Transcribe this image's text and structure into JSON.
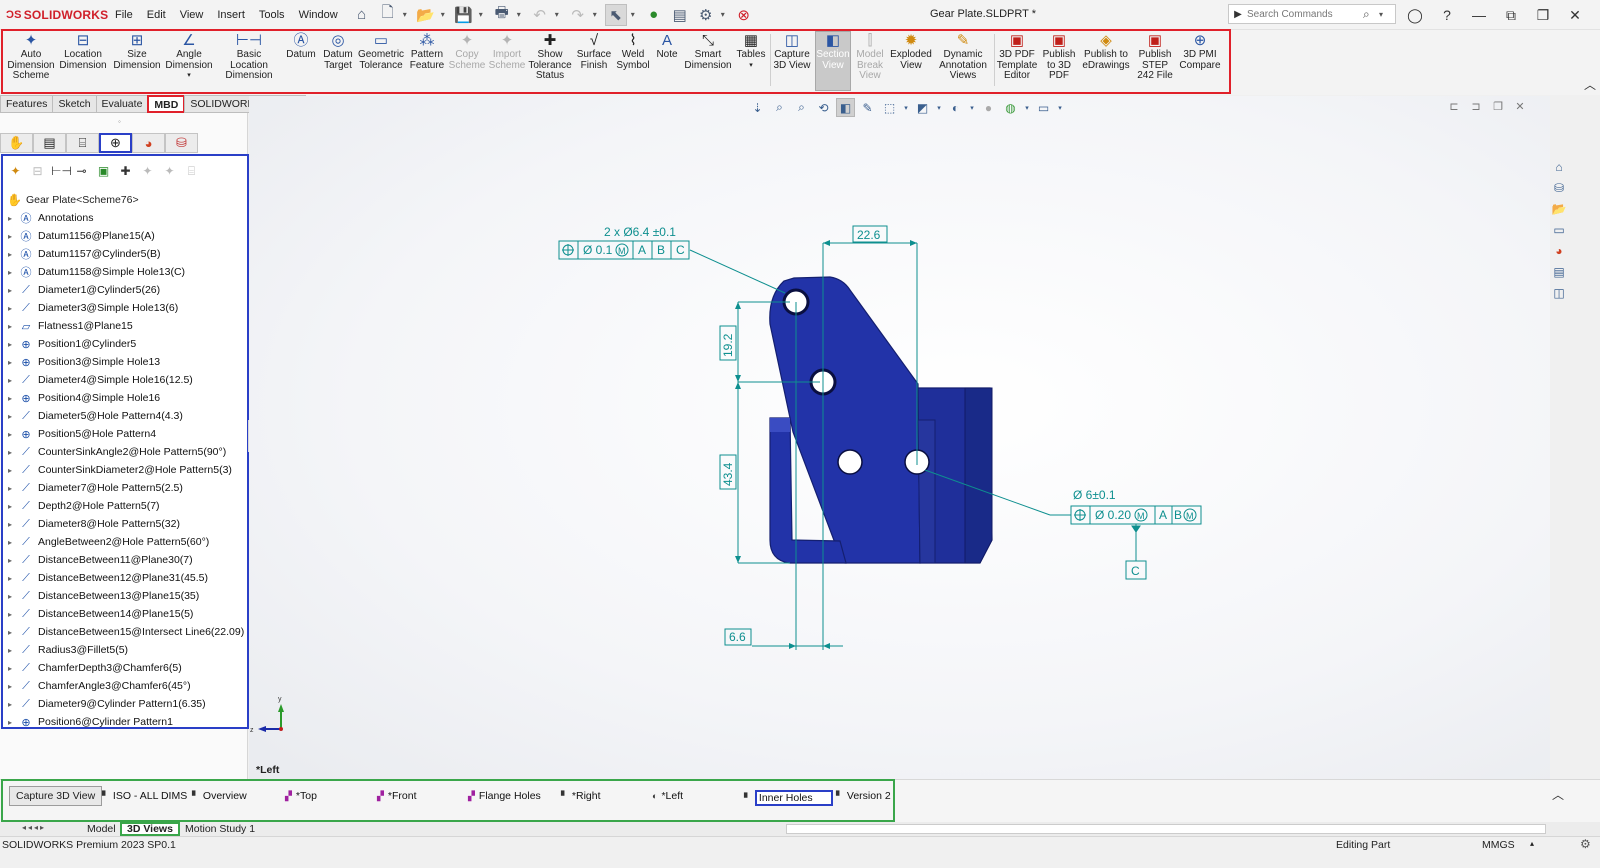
{
  "app": {
    "brand": "SOLIDWORKS",
    "document_title": "Gear Plate.SLDPRT *",
    "menus": [
      "File",
      "Edit",
      "View",
      "Insert",
      "Tools",
      "Window"
    ],
    "search_placeholder": "Search Commands"
  },
  "ribbon": {
    "buttons": [
      {
        "label": "Auto Dimension Scheme",
        "icon": "auto-dimension-icon"
      },
      {
        "label": "Location Dimension",
        "icon": "location-dimension-icon"
      },
      {
        "label": "Size Dimension",
        "icon": "size-dimension-icon"
      },
      {
        "label": "Angle Dimension",
        "icon": "angle-dimension-icon"
      },
      {
        "label": "Basic Location Dimension",
        "icon": "basic-location-icon"
      },
      {
        "label": "Datum",
        "icon": "datum-icon"
      },
      {
        "label": "Datum Target",
        "icon": "datum-target-icon"
      },
      {
        "label": "Geometric Tolerance",
        "icon": "geometric-tolerance-icon"
      },
      {
        "label": "Pattern Feature",
        "icon": "pattern-feature-icon"
      },
      {
        "label": "Copy Scheme",
        "icon": "copy-scheme-icon",
        "disabled": true
      },
      {
        "label": "Import Scheme",
        "icon": "import-scheme-icon",
        "disabled": true
      },
      {
        "label": "Show Tolerance Status",
        "icon": "tolerance-status-icon"
      },
      {
        "label": "Surface Finish",
        "icon": "surface-finish-icon"
      },
      {
        "label": "Weld Symbol",
        "icon": "weld-symbol-icon"
      },
      {
        "label": "Note",
        "icon": "note-icon"
      },
      {
        "label": "Smart Dimension",
        "icon": "smart-dimension-icon"
      },
      {
        "label": "Tables",
        "icon": "tables-icon"
      },
      {
        "label": "Capture 3D View",
        "icon": "capture-3d-view-icon"
      },
      {
        "label": "Section View",
        "icon": "section-view-icon",
        "active": true
      },
      {
        "label": "Model Break View",
        "icon": "model-break-view-icon",
        "disabled": true
      },
      {
        "label": "Exploded View",
        "icon": "exploded-view-icon"
      },
      {
        "label": "Dynamic Annotation Views",
        "icon": "dynamic-annotation-icon"
      },
      {
        "label": "3D PDF Template Editor",
        "icon": "pdf-template-icon"
      },
      {
        "label": "Publish to 3D PDF",
        "icon": "publish-pdf-icon"
      },
      {
        "label": "Publish to eDrawings",
        "icon": "publish-edrawings-icon"
      },
      {
        "label": "Publish STEP 242 File",
        "icon": "publish-step-icon"
      },
      {
        "label": "3D PMI Compare",
        "icon": "pmi-compare-icon"
      }
    ]
  },
  "cm_tabs": [
    "Features",
    "Sketch",
    "Evaluate",
    "MBD",
    "SOLIDWORKS Add-Ins"
  ],
  "tree": {
    "root": "Gear Plate<Scheme76>",
    "items": [
      {
        "label": "Annotations",
        "icon": "annotations-icon"
      },
      {
        "label": "Datum1156@Plane15(A)",
        "icon": "datum-icon"
      },
      {
        "label": "Datum1157@Cylinder5(B)",
        "icon": "datum-icon"
      },
      {
        "label": "Datum1158@Simple Hole13(C)",
        "icon": "datum-icon"
      },
      {
        "label": "Diameter1@Cylinder5(26)",
        "icon": "dimension-icon"
      },
      {
        "label": "Diameter3@Simple Hole13(6)",
        "icon": "dimension-icon"
      },
      {
        "label": "Flatness1@Plane15",
        "icon": "flatness-icon"
      },
      {
        "label": "Position1@Cylinder5",
        "icon": "position-icon"
      },
      {
        "label": "Position3@Simple Hole13",
        "icon": "position-icon"
      },
      {
        "label": "Diameter4@Simple Hole16(12.5)",
        "icon": "dimension-icon"
      },
      {
        "label": "Position4@Simple Hole16",
        "icon": "position-icon"
      },
      {
        "label": "Diameter5@Hole Pattern4(4.3)",
        "icon": "dimension-icon"
      },
      {
        "label": "Position5@Hole Pattern4",
        "icon": "position-icon"
      },
      {
        "label": "CounterSinkAngle2@Hole Pattern5(90°)",
        "icon": "dimension-icon"
      },
      {
        "label": "CounterSinkDiameter2@Hole Pattern5(3)",
        "icon": "dimension-icon"
      },
      {
        "label": "Diameter7@Hole Pattern5(2.5)",
        "icon": "dimension-icon"
      },
      {
        "label": "Depth2@Hole Pattern5(7)",
        "icon": "dimension-icon"
      },
      {
        "label": "Diameter8@Hole Pattern5(32)",
        "icon": "dimension-icon"
      },
      {
        "label": "AngleBetween2@Hole Pattern5(60°)",
        "icon": "dimension-icon"
      },
      {
        "label": "DistanceBetween11@Plane30(7)",
        "icon": "dimension-icon"
      },
      {
        "label": "DistanceBetween12@Plane31(45.5)",
        "icon": "dimension-icon"
      },
      {
        "label": "DistanceBetween13@Plane15(35)",
        "icon": "dimension-icon"
      },
      {
        "label": "DistanceBetween14@Plane15(5)",
        "icon": "dimension-icon"
      },
      {
        "label": "DistanceBetween15@Intersect Line6(22.09)",
        "icon": "dimension-icon"
      },
      {
        "label": "Radius3@Fillet5(5)",
        "icon": "dimension-icon"
      },
      {
        "label": "ChamferDepth3@Chamfer6(5)",
        "icon": "dimension-icon"
      },
      {
        "label": "ChamferAngle3@Chamfer6(45°)",
        "icon": "dimension-icon"
      },
      {
        "label": "Diameter9@Cylinder Pattern1(6.35)",
        "icon": "dimension-icon"
      },
      {
        "label": "Position6@Cylinder Pattern1",
        "icon": "position-icon"
      }
    ]
  },
  "annotations": {
    "hole_callout": "2 x Ø6.4 ±0.1",
    "fcf1": {
      "tol": "Ø 0.1",
      "mod": "M",
      "datums": [
        "A",
        "B",
        "C"
      ]
    },
    "dim_22_6": "22.6",
    "dim_19_2": "19.2",
    "dim_43_4": "43.4",
    "dim_6_6": "6.6",
    "hole2_callout": "Ø 6±0.1",
    "fcf2": {
      "tol": "Ø 0.20",
      "mod": "M",
      "datums": [
        "A",
        "B"
      ],
      "datum_b_mod": "M"
    },
    "datum_c": "C"
  },
  "graphics": {
    "view_name": "*Left",
    "part_color": "#2233a8",
    "pmi_color": "#0e8f8f",
    "triad_x": "x",
    "triad_y": "y",
    "triad_z": "z"
  },
  "views_bar": {
    "capture_button": "Capture 3D View",
    "views": [
      "ISO - ALL DIMS",
      "Overview",
      "*Top",
      "*Front",
      "Flange Holes",
      "*Right",
      "*Left",
      "Inner Holes",
      "Version 2"
    ]
  },
  "doc_tabs": [
    "Model",
    "3D Views",
    "Motion Study 1"
  ],
  "status": {
    "product": "SOLIDWORKS Premium 2023 SP0.1",
    "mode": "Editing Part",
    "units": "MMGS"
  }
}
